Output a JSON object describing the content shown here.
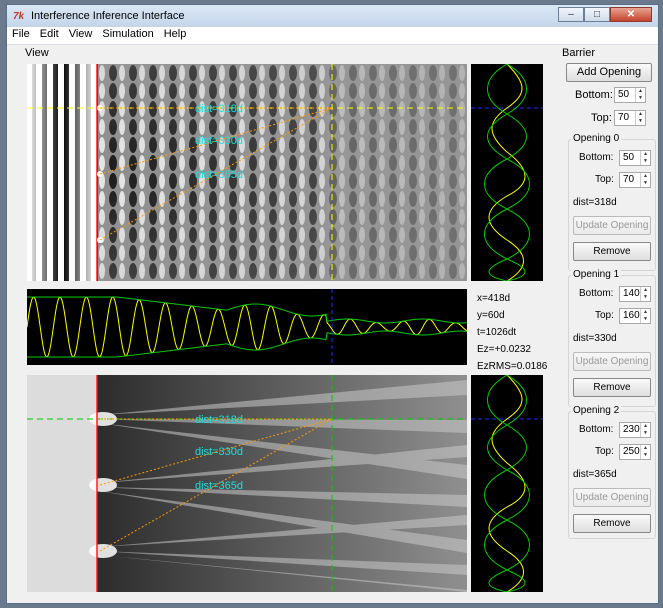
{
  "window": {
    "title": "Interference Inference Interface",
    "icon_text": "7k"
  },
  "window_buttons": {
    "minimize": "–",
    "maximize": "□",
    "close": "✕"
  },
  "menu": [
    "File",
    "Edit",
    "View",
    "Simulation",
    "Help"
  ],
  "view": {
    "label": "View"
  },
  "distances": [
    "dist=318d",
    "dist=330d",
    "dist=365d"
  ],
  "readout": {
    "x": "x=418d",
    "y": "y=60d",
    "t": "t=1026dt",
    "ez": "Ez=+0.0232",
    "ezrms": "EzRMS=0.0186"
  },
  "barrier": {
    "label": "Barrier",
    "add_opening": "Add Opening",
    "bottom_label": "Bottom:",
    "top_label": "Top:",
    "bottom": "50",
    "top": "70"
  },
  "openings": [
    {
      "title": "Opening 0",
      "bottom": "50",
      "top": "70",
      "dist": "dist=318d"
    },
    {
      "title": "Opening 1",
      "bottom": "140",
      "top": "160",
      "dist": "dist=330d"
    },
    {
      "title": "Opening 2",
      "bottom": "230",
      "top": "250",
      "dist": "dist=365d"
    }
  ],
  "opening_labels": {
    "bottom": "Bottom:",
    "top": "Top:",
    "update": "Update Opening",
    "remove": "Remove"
  },
  "colors": {
    "yellow": "#ffff00",
    "green": "#00cc00",
    "cyan": "#19e0e0",
    "orange": "#ff9900",
    "red": "#ff2020",
    "blue": "#1a2aff"
  }
}
